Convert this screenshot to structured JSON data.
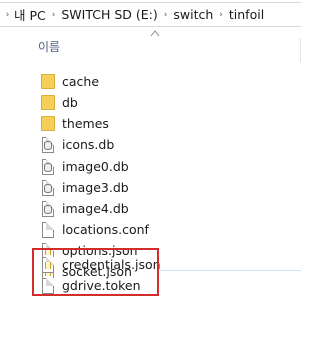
{
  "addressbar": {
    "crumbs": [
      "내 PC",
      "SWITCH SD (E:)",
      "switch",
      "tinfoil"
    ]
  },
  "column": {
    "name_header": "이름"
  },
  "files": [
    {
      "name": "cache",
      "type": "folder"
    },
    {
      "name": "db",
      "type": "folder"
    },
    {
      "name": "themes",
      "type": "folder"
    },
    {
      "name": "icons.db",
      "type": "db"
    },
    {
      "name": "image0.db",
      "type": "db"
    },
    {
      "name": "image3.db",
      "type": "db"
    },
    {
      "name": "image4.db",
      "type": "db"
    },
    {
      "name": "locations.conf",
      "type": "file"
    },
    {
      "name": "options.json",
      "type": "json"
    },
    {
      "name": "socket.json",
      "type": "json"
    },
    {
      "name": "credentials.json",
      "type": "json"
    },
    {
      "name": "gdrive.token",
      "type": "file"
    }
  ],
  "colors": {
    "highlight": "#d42b2b",
    "folder": "#f6cf5a"
  }
}
